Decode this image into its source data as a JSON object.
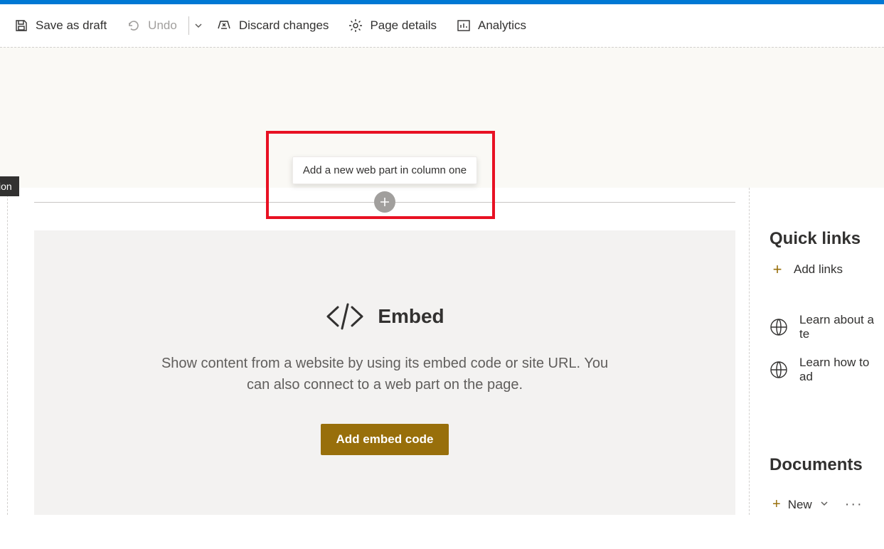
{
  "toolbar": {
    "save_draft": "Save as draft",
    "undo": "Undo",
    "discard": "Discard changes",
    "page_details": "Page details",
    "analytics": "Analytics"
  },
  "section": {
    "label": "Section",
    "add_tooltip": "Add a new web part in column one"
  },
  "embed": {
    "title": "Embed",
    "description": "Show content from a website by using its embed code or site URL. You can also connect to a web part on the page.",
    "button": "Add embed code"
  },
  "sidebar": {
    "quick_links_title": "Quick links",
    "add_links": "Add links",
    "links": [
      {
        "label": "Learn about a te"
      },
      {
        "label": "Learn how to ad"
      }
    ],
    "documents_title": "Documents",
    "new_label": "New"
  },
  "colors": {
    "accent": "#986f0b",
    "highlight": "#e81123"
  }
}
